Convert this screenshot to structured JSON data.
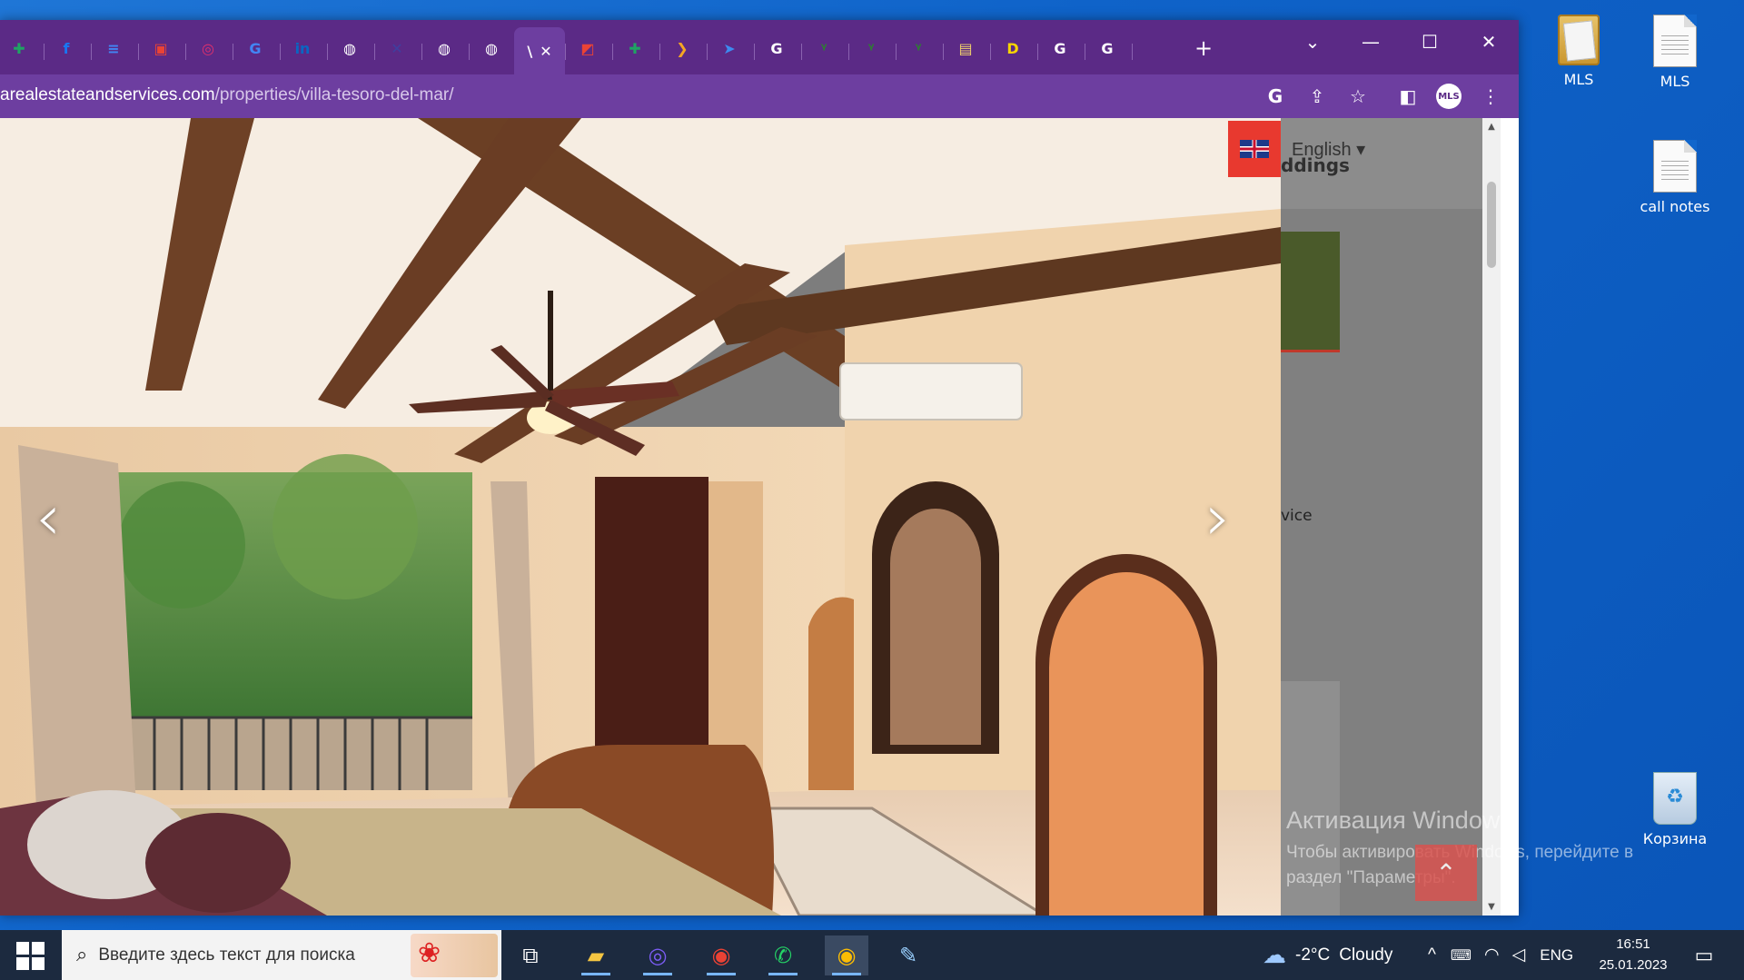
{
  "desktop": {
    "icons": [
      {
        "label": "MLS",
        "type": "folder-icon"
      },
      {
        "label": "MLS",
        "type": "document-icon"
      },
      {
        "label": "call notes",
        "type": "document-icon"
      },
      {
        "label": "Корзина",
        "type": "recycle-bin-icon"
      }
    ]
  },
  "browser": {
    "tabs": [
      {
        "icon": "sheets-icon",
        "color": "#1fa463"
      },
      {
        "icon": "facebook-icon",
        "color": "#1877f2"
      },
      {
        "icon": "docs-icon",
        "color": "#4285f4"
      },
      {
        "icon": "calendar-icon",
        "color": "#ea4335"
      },
      {
        "icon": "instagram-icon",
        "color": "#e1306c"
      },
      {
        "icon": "translate-icon",
        "color": "#4285f4"
      },
      {
        "icon": "linkedin-icon",
        "color": "#0a66c2"
      },
      {
        "icon": "globe-icon",
        "color": "#ffffff"
      },
      {
        "icon": "x-icon",
        "color": "#3f3f9f"
      },
      {
        "icon": "globe-icon",
        "color": "#ffffff"
      },
      {
        "icon": "globe-icon",
        "color": "#ffffff"
      },
      {
        "icon": "active-tab",
        "color": "#ffffff"
      },
      {
        "icon": "maps-icon",
        "color": "#ea4335"
      },
      {
        "icon": "sheets-icon",
        "color": "#1fa463"
      },
      {
        "icon": "pin-icon",
        "color": "#f5a623"
      },
      {
        "icon": "send-icon",
        "color": "#3d8bf0"
      },
      {
        "icon": "google-icon",
        "color": "#ffffff"
      },
      {
        "icon": "leaf-icon",
        "color": "#2e7d32"
      },
      {
        "icon": "leaf-icon",
        "color": "#2e7d32"
      },
      {
        "icon": "leaf-icon",
        "color": "#2e7d32"
      },
      {
        "icon": "contacts-icon",
        "color": "#f3d46b"
      },
      {
        "icon": "d-icon",
        "color": "#f7d400"
      },
      {
        "icon": "google-icon",
        "color": "#ffffff"
      },
      {
        "icon": "google-icon",
        "color": "#ffffff"
      }
    ],
    "active_tab_text": "\\",
    "close_glyph": "✕",
    "new_tab_glyph": "+",
    "window_controls": {
      "dropdown": "⌄",
      "minimize": "—",
      "maximize": "☐",
      "close": "✕"
    },
    "url": {
      "domain": "arealestateandservices.com",
      "path": "/properties/villa-tesoro-del-mar/"
    },
    "toolbar_icons": [
      "google-icon",
      "share-icon",
      "star-icon",
      "sidepanel-icon",
      "profile-avatar",
      "menu-icon"
    ],
    "profile_text": "MLS",
    "colors": {
      "tabbar": "#5b2a86",
      "addrbar": "#6d3ea0"
    }
  },
  "page": {
    "language": {
      "label": "English ▾"
    },
    "sidebar_heading": "ddings",
    "sidebar_text": "vice",
    "gallery": {
      "prev": "‹",
      "next": "›"
    },
    "scroll_top_glyph": "⌃"
  },
  "watermark": {
    "title": "Активация Windows",
    "line1": "Чтобы активировать Windows, перейдите в",
    "line2": "раздел \"Параметры\"."
  },
  "taskbar": {
    "search_placeholder": "Введите здесь текст для поиска",
    "apps": [
      "task-view-icon",
      "file-explorer-icon",
      "viber-icon",
      "chrome-icon",
      "whatsapp-icon",
      "chrome-profile-icon",
      "paint-icon"
    ],
    "weather": {
      "temp": "-2°C",
      "condition": "Cloudy"
    },
    "tray": {
      "chevron": "^",
      "lang": "ENG"
    },
    "clock": {
      "time": "16:51",
      "date": "25.01.2023"
    }
  }
}
